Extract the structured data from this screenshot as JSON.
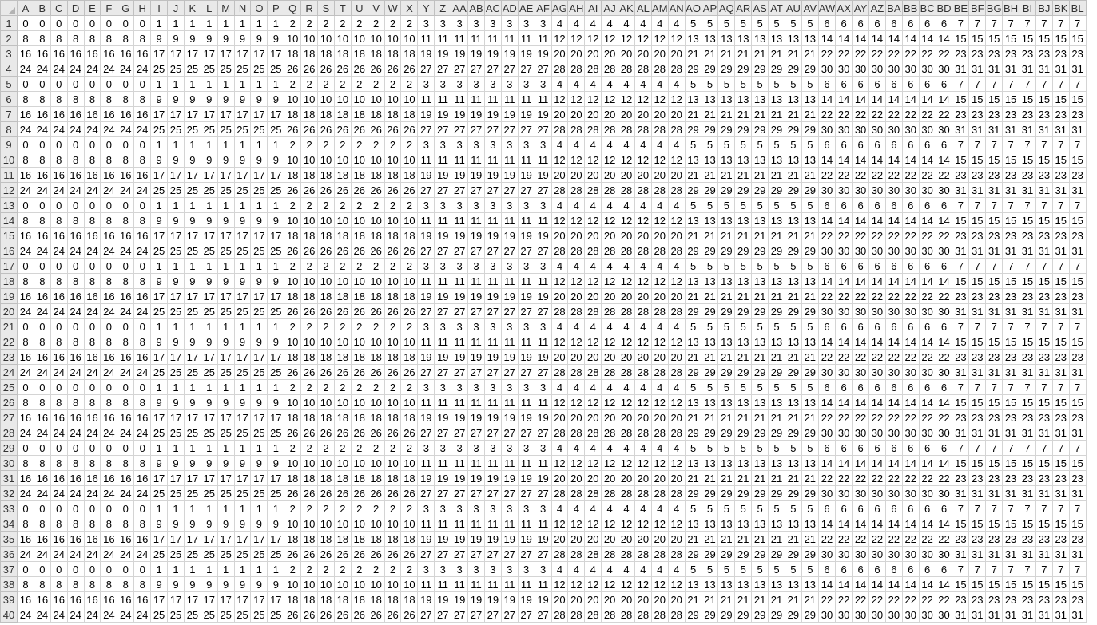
{
  "sheet": {
    "column_headers": [
      "A",
      "B",
      "C",
      "D",
      "E",
      "F",
      "G",
      "H",
      "I",
      "J",
      "K",
      "L",
      "M",
      "N",
      "O",
      "P",
      "Q",
      "R",
      "S",
      "T",
      "U",
      "V",
      "W",
      "X",
      "Y",
      "Z",
      "AA",
      "AB",
      "AC",
      "AD",
      "AE",
      "AF",
      "AG",
      "AH",
      "AI",
      "AJ",
      "AK",
      "AL",
      "AM",
      "AN",
      "AO",
      "AP",
      "AQ",
      "AR",
      "AS",
      "AT",
      "AU",
      "AV",
      "AW",
      "AX",
      "AY",
      "AZ",
      "BA",
      "BB",
      "BC",
      "BD",
      "BE",
      "BF",
      "BG",
      "BH",
      "BI",
      "BJ",
      "BK",
      "BL"
    ],
    "row_headers": [
      "1",
      "2",
      "3",
      "4",
      "5",
      "6",
      "7",
      "8",
      "9",
      "10",
      "11",
      "12",
      "13",
      "14",
      "15",
      "16",
      "17",
      "18",
      "19",
      "20",
      "21",
      "22",
      "23",
      "24",
      "25",
      "26",
      "27",
      "28",
      "29",
      "30",
      "31",
      "32",
      "33",
      "34",
      "35",
      "36",
      "37",
      "38",
      "39",
      "40"
    ],
    "row_patterns": [
      [
        "0",
        "0",
        "0",
        "0",
        "0",
        "0",
        "0",
        "0",
        "1",
        "1",
        "1",
        "1",
        "1",
        "1",
        "1",
        "1",
        "2",
        "2",
        "2",
        "2",
        "2",
        "2",
        "2",
        "2",
        "3",
        "3",
        "3",
        "3",
        "3",
        "3",
        "3",
        "3",
        "4",
        "4",
        "4",
        "4",
        "4",
        "4",
        "4",
        "4",
        "5",
        "5",
        "5",
        "5",
        "5",
        "5",
        "5",
        "5",
        "6",
        "6",
        "6",
        "6",
        "6",
        "6",
        "6",
        "6",
        "7",
        "7",
        "7",
        "7",
        "7",
        "7",
        "7",
        "7"
      ],
      [
        "8",
        "8",
        "8",
        "8",
        "8",
        "8",
        "8",
        "8",
        "9",
        "9",
        "9",
        "9",
        "9",
        "9",
        "9",
        "9",
        "10",
        "10",
        "10",
        "10",
        "10",
        "10",
        "10",
        "10",
        "11",
        "11",
        "11",
        "11",
        "11",
        "11",
        "11",
        "11",
        "12",
        "12",
        "12",
        "12",
        "12",
        "12",
        "12",
        "12",
        "13",
        "13",
        "13",
        "13",
        "13",
        "13",
        "13",
        "13",
        "14",
        "14",
        "14",
        "14",
        "14",
        "14",
        "14",
        "14",
        "15",
        "15",
        "15",
        "15",
        "15",
        "15",
        "15",
        "15"
      ],
      [
        "16",
        "16",
        "16",
        "16",
        "16",
        "16",
        "16",
        "16",
        "17",
        "17",
        "17",
        "17",
        "17",
        "17",
        "17",
        "17",
        "18",
        "18",
        "18",
        "18",
        "18",
        "18",
        "18",
        "18",
        "19",
        "19",
        "19",
        "19",
        "19",
        "19",
        "19",
        "19",
        "20",
        "20",
        "20",
        "20",
        "20",
        "20",
        "20",
        "20",
        "21",
        "21",
        "21",
        "21",
        "21",
        "21",
        "21",
        "21",
        "22",
        "22",
        "22",
        "22",
        "22",
        "22",
        "22",
        "22",
        "23",
        "23",
        "23",
        "23",
        "23",
        "23",
        "23",
        "23"
      ],
      [
        "24",
        "24",
        "24",
        "24",
        "24",
        "24",
        "24",
        "24",
        "25",
        "25",
        "25",
        "25",
        "25",
        "25",
        "25",
        "25",
        "26",
        "26",
        "26",
        "26",
        "26",
        "26",
        "26",
        "26",
        "27",
        "27",
        "27",
        "27",
        "27",
        "27",
        "27",
        "27",
        "28",
        "28",
        "28",
        "28",
        "28",
        "28",
        "28",
        "28",
        "29",
        "29",
        "29",
        "29",
        "29",
        "29",
        "29",
        "29",
        "30",
        "30",
        "30",
        "30",
        "30",
        "30",
        "30",
        "30",
        "31",
        "31",
        "31",
        "31",
        "31",
        "31",
        "31",
        "31"
      ]
    ]
  }
}
